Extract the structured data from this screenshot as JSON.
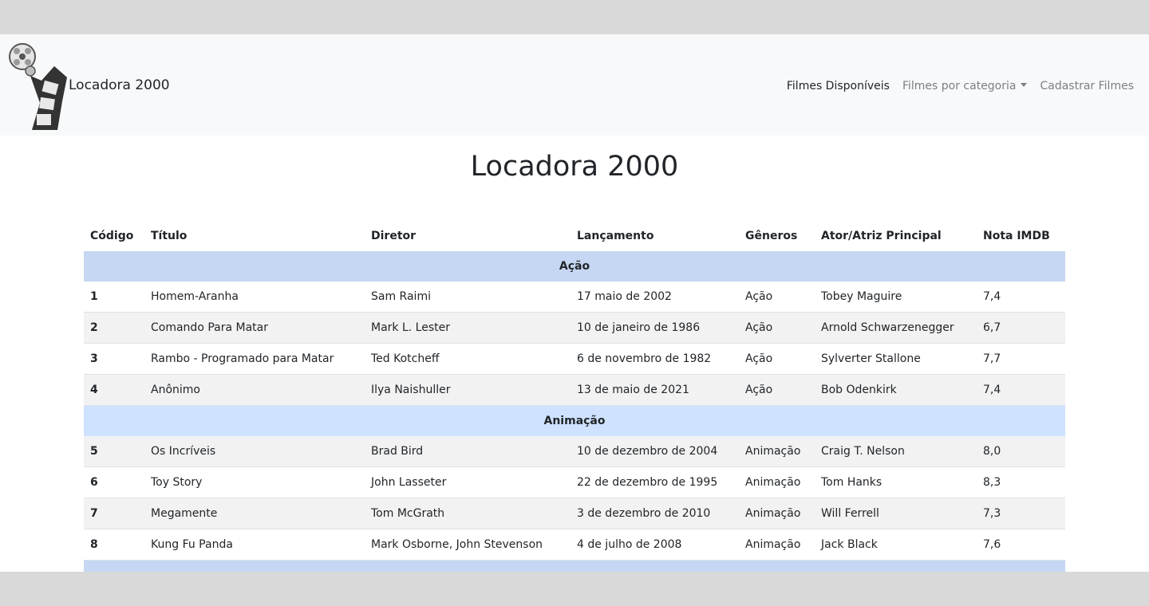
{
  "navbar": {
    "brand": "Locadora 2000",
    "links": [
      {
        "label": "Filmes Disponíveis"
      },
      {
        "label": "Filmes por categoria"
      },
      {
        "label": "Cadastrar Filmes"
      }
    ]
  },
  "page": {
    "title": "Locadora 2000"
  },
  "table": {
    "headers": [
      "Código",
      "Título",
      "Diretor",
      "Lançamento",
      "Gêneros",
      "Ator/Atriz Principal",
      "Nota IMDB"
    ],
    "groups": [
      {
        "name": "Ação",
        "rows": [
          [
            "1",
            "Homem-Aranha",
            "Sam Raimi",
            "17 maio de 2002",
            "Ação",
            "Tobey Maguire",
            "7,4"
          ],
          [
            "2",
            "Comando Para Matar",
            "Mark L. Lester",
            "10 de janeiro de 1986",
            "Ação",
            "Arnold Schwarzenegger",
            "6,7"
          ],
          [
            "3",
            "Rambo - Programado para Matar",
            "Ted Kotcheff",
            "6 de novembro de 1982",
            "Ação",
            "Sylverter Stallone",
            "7,7"
          ],
          [
            "4",
            "Anônimo",
            "Ilya Naishuller",
            "13 de maio de 2021",
            "Ação",
            "Bob Odenkirk",
            "7,4"
          ]
        ]
      },
      {
        "name": "Animação",
        "rows": [
          [
            "5",
            "Os Incríveis",
            "Brad Bird",
            "10 de dezembro de 2004",
            "Animação",
            "Craig T. Nelson",
            "8,0"
          ],
          [
            "6",
            "Toy Story",
            "John Lasseter",
            "22 de dezembro de 1995",
            "Animação",
            "Tom Hanks",
            "8,3"
          ],
          [
            "7",
            "Megamente",
            "Tom McGrath",
            "3 de dezembro de 2010",
            "Animação",
            "Will Ferrell",
            "7,3"
          ],
          [
            "8",
            "Kung Fu Panda",
            "Mark Osborne, John Stevenson",
            "4 de julho de 2008",
            "Animação",
            "Jack Black",
            "7,6"
          ]
        ]
      }
    ]
  },
  "colors": {
    "navbar_bg": "#f8f9fa",
    "group_row_bg": "#c5d7f2",
    "striped_row_bg": "#f2f2f2",
    "letterbox_bg": "#d9d9d9"
  },
  "icons": {
    "brand_logo": "film-reel-icon",
    "dropdown": "caret-down-icon"
  }
}
